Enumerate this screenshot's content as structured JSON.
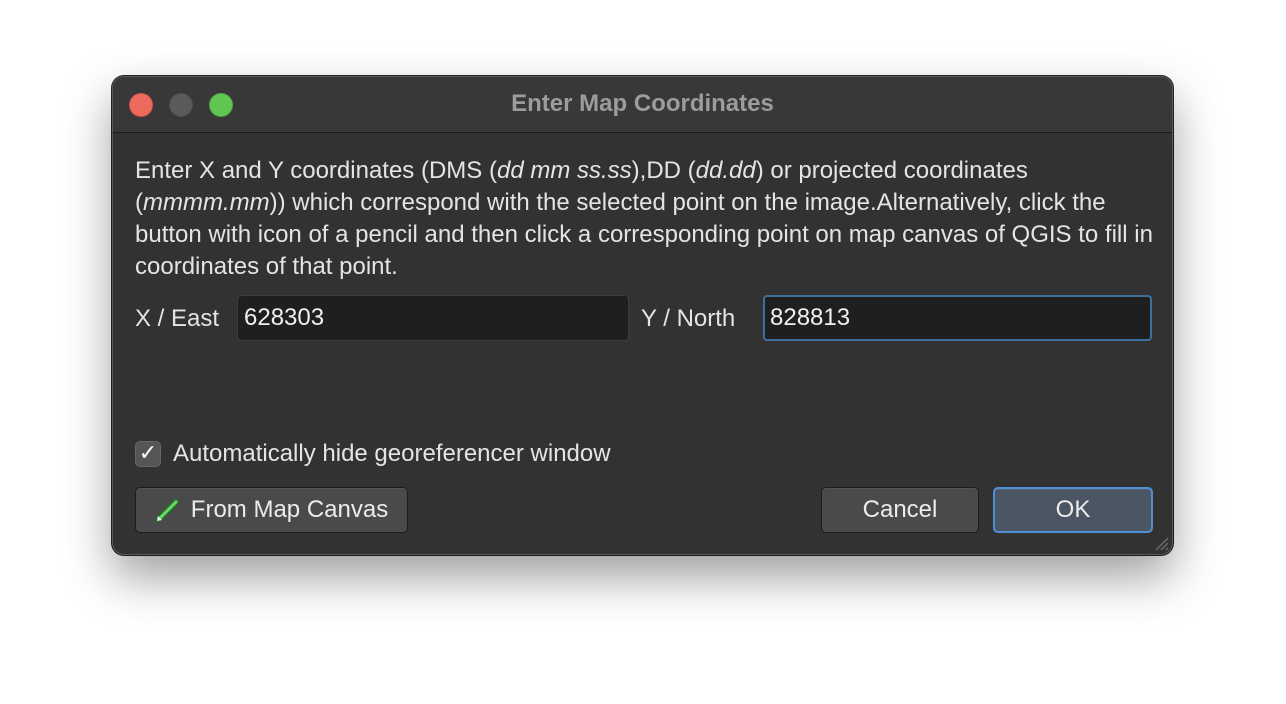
{
  "window": {
    "title": "Enter Map Coordinates"
  },
  "description": {
    "part1": "Enter X and Y coordinates (DMS (",
    "dms_format": "dd mm ss.ss",
    "part2": "),DD (",
    "dd_format": "dd.dd",
    "part3": ") or projected coordinates (",
    "projected_format": "mmmm.mm",
    "part4": ")) which correspond with the selected point on the image.Alternatively, click the button with icon of a pencil and then click a corresponding point on map canvas of QGIS to fill in coordinates of that point."
  },
  "fields": {
    "x_label": "X / East",
    "x_value": "628303",
    "y_label": "Y / North",
    "y_value": "828813"
  },
  "options": {
    "auto_hide_label": "Automatically hide georeferencer window",
    "auto_hide_checked": true
  },
  "buttons": {
    "from_map_canvas": "From Map Canvas",
    "cancel": "Cancel",
    "ok": "OK"
  },
  "icons": {
    "from_map_canvas": "pencil-icon",
    "checkbox_mark": "checkmark-icon"
  },
  "colors": {
    "close": "#ed6a5e",
    "minimize": "#5a5a5a",
    "zoom": "#61c554",
    "focus_ring": "#4f8fd6",
    "dialog_bg": "#323232"
  }
}
